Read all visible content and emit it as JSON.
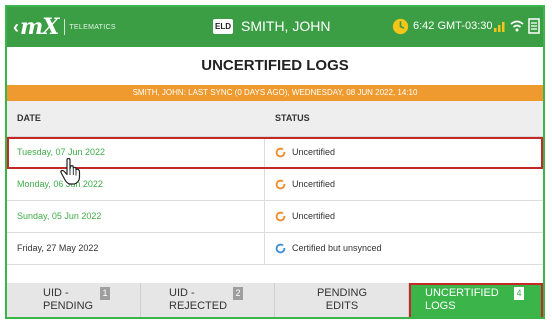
{
  "header": {
    "back_glyph": "‹",
    "brand": "mX",
    "tagline": "TELEMATICS",
    "eld_badge": "ELD",
    "driver": "SMITH, JOHN",
    "time": "6:42 GMT-03:30",
    "icons": [
      "clock-icon",
      "signal-icon",
      "wifi-icon",
      "log-icon",
      "menu-icon"
    ]
  },
  "page": {
    "title": "UNCERTIFIED LOGS",
    "sync_banner": "SMITH, JOHN: LAST SYNC (0 DAYS AGO), WEDNESDAY, 08 JUN 2022, 14:10"
  },
  "table": {
    "headers": {
      "date": "DATE",
      "status": "STATUS"
    },
    "rows": [
      {
        "date": "Tuesday, 07 Jun 2022",
        "status": "Uncertified",
        "date_color": "green",
        "icon": "uncertified-icon"
      },
      {
        "date": "Monday, 06 Jun 2022",
        "status": "Uncertified",
        "date_color": "green",
        "icon": "uncertified-icon"
      },
      {
        "date": "Sunday, 05 Jun 2022",
        "status": "Uncertified",
        "date_color": "green",
        "icon": "uncertified-icon"
      },
      {
        "date": "Friday, 27 May 2022",
        "status": "Certified but unsynced",
        "date_color": "dark",
        "icon": "unsynced-icon"
      }
    ]
  },
  "tabs": [
    {
      "line1": "UID -",
      "line2": "PENDING",
      "count": "1"
    },
    {
      "line1": "UID -",
      "line2": "REJECTED",
      "count": "2"
    },
    {
      "line1": "PENDING",
      "line2": "EDITS",
      "count": ""
    },
    {
      "line1": "UNCERTIFIED",
      "line2": "LOGS",
      "count": "4"
    }
  ],
  "colors": {
    "accent_green": "#3bb54a",
    "banner_orange": "#ef9a2e",
    "highlight_red": "#c62828",
    "uncertified_icon": "#ef8a2a",
    "unsynced_icon": "#3a8fd6"
  }
}
